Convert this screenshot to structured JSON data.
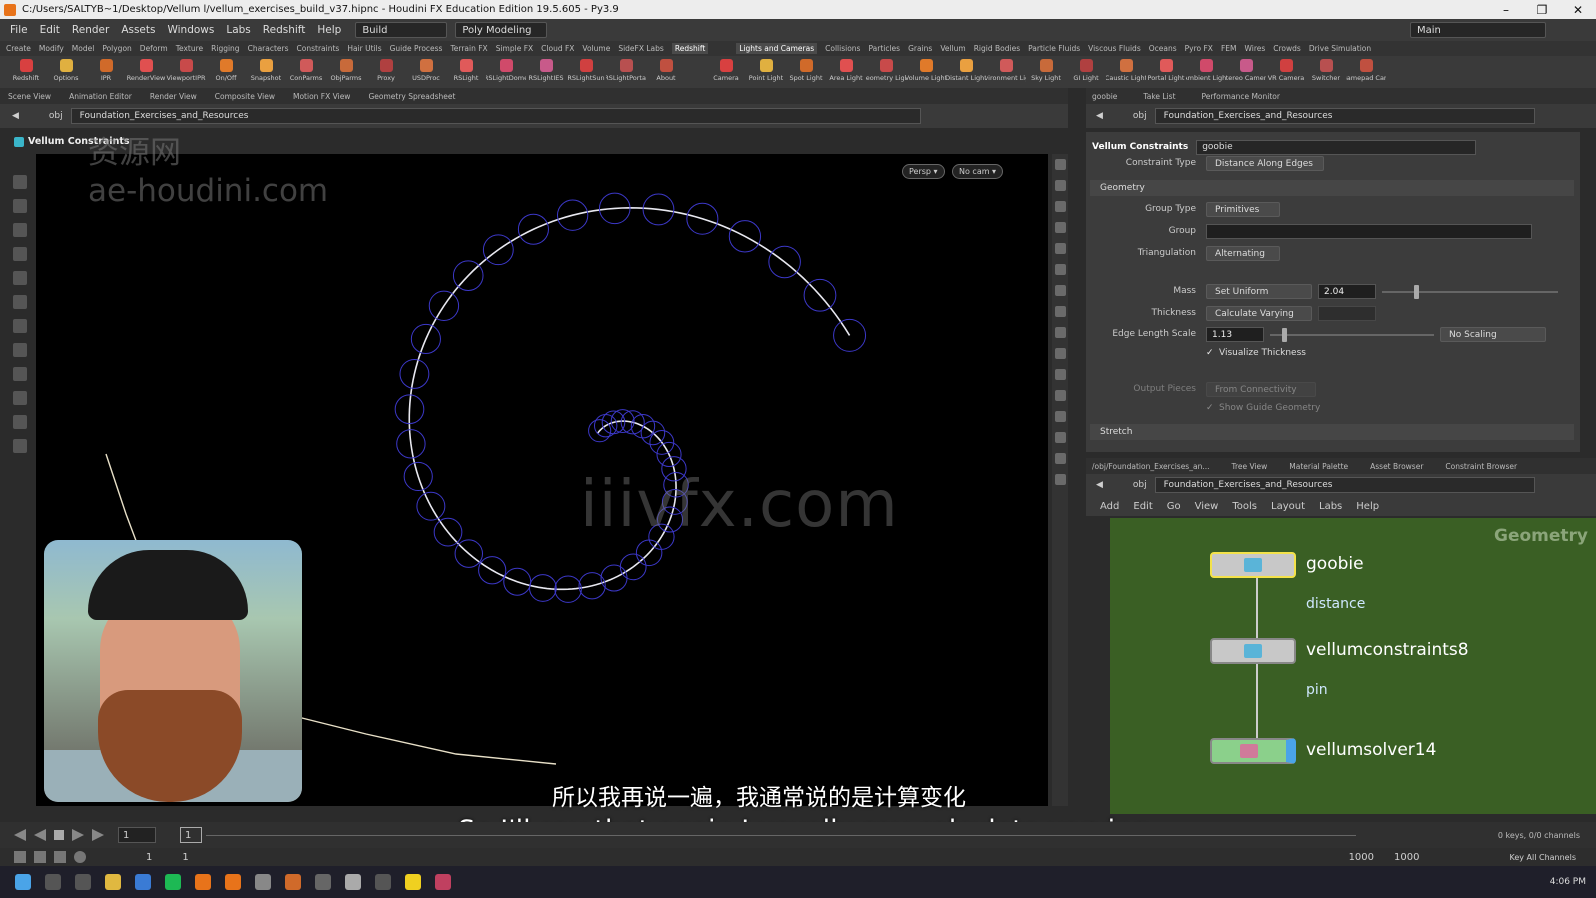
{
  "window": {
    "title": "C:/Users/SALTYB~1/Desktop/Vellum l/vellum_exercises_build_v37.hipnc - Houdini FX Education Edition 19.5.605 - Py3.9",
    "min": "–",
    "max": "❐",
    "close": "✕"
  },
  "menu": {
    "items": [
      "File",
      "Edit",
      "Render",
      "Assets",
      "Windows",
      "Labs",
      "Redshift",
      "Help"
    ],
    "build": "Build",
    "desktop": "Poly Modeling",
    "main": "Main"
  },
  "shelf": {
    "tabs_left": [
      "Create",
      "Modify",
      "Model",
      "Polygon",
      "Deform",
      "Texture",
      "Rigging",
      "Characters",
      "Constraints",
      "Hair Utils",
      "Guide Process",
      "Terrain FX",
      "Simple FX",
      "Cloud FX",
      "Volume",
      "SideFX Labs",
      "Redshift"
    ],
    "tabs_right": [
      "Lights and Cameras",
      "Collisions",
      "Particles",
      "Grains",
      "Vellum",
      "Rigid Bodies",
      "Particle Fluids",
      "Viscous Fluids",
      "Oceans",
      "Pyro FX",
      "FEM",
      "Wires",
      "Crowds",
      "Drive Simulation"
    ],
    "tools_left": [
      "Redshift",
      "Options",
      "IPR",
      "RenderView",
      "ViewportIPR",
      "On/Off",
      "Snapshot",
      "ConParms",
      "ObjParms",
      "Proxy",
      "USDProc",
      "RSLight",
      "RSLightDome",
      "RSLightIES",
      "RSLightSun",
      "RSLightPortal",
      "About"
    ],
    "tools_right": [
      "Camera",
      "Point Light",
      "Spot Light",
      "Area Light",
      "Geometry Light",
      "Volume Light",
      "Distant Light",
      "Environment Light",
      "Sky Light",
      "GI Light",
      "Caustic Light",
      "Portal Light",
      "Ambient Light",
      "Stereo Camera",
      "VR Camera",
      "Switcher",
      "Gamepad Cam"
    ]
  },
  "panels": {
    "left_tabs": [
      "Scene View",
      "Animation Editor",
      "Render View",
      "Composite View",
      "Motion FX View",
      "Geometry Spreadsheet"
    ],
    "obj": "obj",
    "path": "Foundation_Exercises_and_Resources",
    "viewport_title": "Vellum Constraints",
    "persp": "Persp ▾",
    "nocam": "No cam ▾"
  },
  "watermarks": {
    "site1": "资源网",
    "site2": "ae-houdini.com",
    "site3": "iiivfx.com"
  },
  "right_panel": {
    "tabs": [
      "goobie",
      "Take List",
      "Performance Monitor"
    ],
    "node_type": "Vellum Constraints",
    "node_name": "goobie",
    "constraint_type_label": "Constraint Type",
    "constraint_type": "Distance Along Edges",
    "geometry_section": "Geometry",
    "group_type_label": "Group Type",
    "group_type": "Primitives",
    "group_label": "Group",
    "triangulation_label": "Triangulation",
    "triangulation": "Alternating",
    "mass_label": "Mass",
    "mass_mode": "Set Uniform",
    "mass_value": "2.04",
    "thickness_label": "Thickness",
    "thickness_mode": "Calculate Varying",
    "edge_scale_label": "Edge Length Scale",
    "edge_scale_value": "1.13",
    "edge_scale_mode": "No Scaling",
    "visualize_thickness": "Visualize Thickness",
    "output_pieces_label": "Output Pieces",
    "output_pieces": "From Connectivity",
    "show_guide": "Show Guide Geometry",
    "stretch_section": "Stretch"
  },
  "network": {
    "tabs": [
      "/obj/Foundation_Exercises_an...",
      "Tree View",
      "Material Palette",
      "Asset Browser",
      "Constraint Browser"
    ],
    "menu": [
      "Add",
      "Edit",
      "Go",
      "View",
      "Tools",
      "Layout",
      "Labs",
      "Help"
    ],
    "context": "Geometry",
    "nodes": [
      {
        "name": "goobie",
        "sub": "distance"
      },
      {
        "name": "vellumconstraints8",
        "sub": "pin"
      },
      {
        "name": "vellumsolver14",
        "sub": ""
      }
    ]
  },
  "timeline": {
    "frame": "1",
    "start": "1",
    "start2": "1",
    "end": "1000",
    "end2": "1000",
    "keys": "0 keys, 0/0 channels",
    "keyall": "Key All Channels"
  },
  "subtitles": {
    "cn": "所以我再说一遍，我通常说的是计算变化",
    "en": "So I'll say that again I usually say calculate varying"
  },
  "taskbar": {
    "clock": "4:06 PM"
  }
}
